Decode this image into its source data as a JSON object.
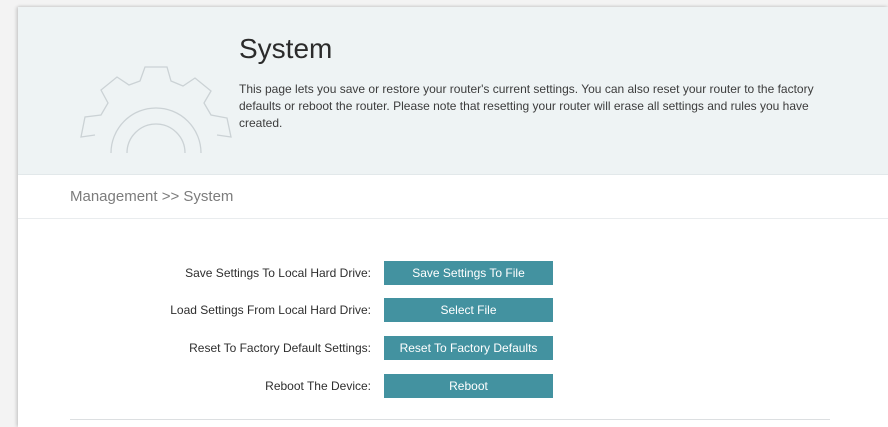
{
  "header": {
    "title": "System",
    "description": "This page lets you save or restore your router's current settings. You can also reset your router to the factory defaults or reboot the router. Please note that resetting your router will erase all settings and rules you have created.",
    "icon": "gear-icon"
  },
  "breadcrumb": "Management >> System",
  "actions": [
    {
      "label": "Save Settings To Local Hard Drive:",
      "button": "Save Settings To File"
    },
    {
      "label": "Load Settings From Local Hard Drive:",
      "button": "Select File"
    },
    {
      "label": "Reset To Factory Default Settings:",
      "button": "Reset To Factory Defaults"
    },
    {
      "label": "Reboot The Device:",
      "button": "Reboot"
    }
  ],
  "colors": {
    "button": "#4392a0",
    "header_bg": "#eef3f4"
  }
}
